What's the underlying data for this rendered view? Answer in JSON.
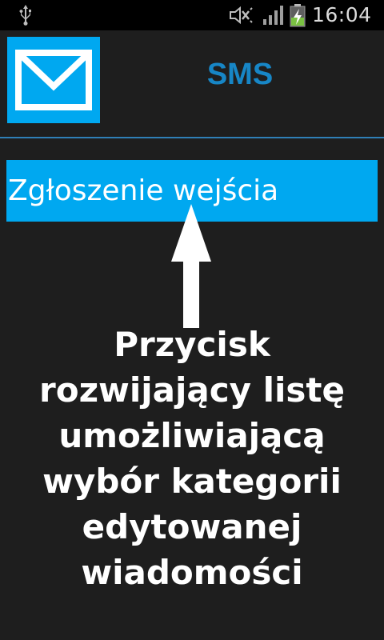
{
  "status_bar": {
    "time": "16:04",
    "icons": [
      "usb-icon",
      "mute-icon",
      "signal-icon",
      "battery-charging-icon"
    ]
  },
  "app_header": {
    "title": "SMS",
    "logo_icon": "envelope-icon",
    "title_color": "#1786c6",
    "logo_color": "#00a8f0"
  },
  "category_button": {
    "label": "Zgłoszenie wejścia",
    "background": "#00a8f0"
  },
  "annotation": {
    "arrow_icon": "up-arrow-icon",
    "lines": [
      "Przycisk",
      "rozwijający listę",
      "umożliwiającą",
      "wybór kategorii",
      "edytowanej",
      "wiadomości"
    ]
  }
}
